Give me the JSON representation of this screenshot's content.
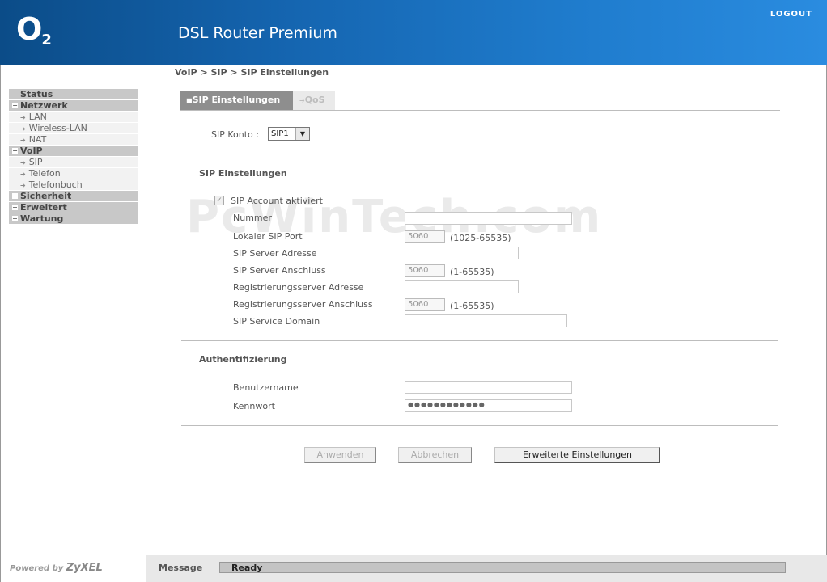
{
  "header": {
    "logo": "O",
    "logo_sub": "2",
    "product": "DSL Router Premium",
    "logout": "LOGOUT"
  },
  "breadcrumb": "VoIP > SIP > SIP Einstellungen",
  "sidebar": {
    "status": "Status",
    "netzwerk": "Netzwerk",
    "lan": "LAN",
    "wlan": "Wireless-LAN",
    "nat": "NAT",
    "voip": "VoIP",
    "sip": "SIP",
    "telefon": "Telefon",
    "telefonbuch": "Telefonbuch",
    "sicherheit": "Sicherheit",
    "erweitert": "Erweitert",
    "wartung": "Wartung"
  },
  "tabs": {
    "active": "SIP Einstellungen",
    "inactive": "QoS"
  },
  "form": {
    "sip_konto_label": "SIP Konto :",
    "sip_konto_value": "SIP1",
    "section_sip": "SIP Einstellungen",
    "sip_account_label": "SIP Account aktiviert",
    "nummer_label": "Nummer",
    "lokaler_port_label": "Lokaler SIP Port",
    "lokaler_port_value": "5060",
    "lokaler_port_range": "(1025-65535)",
    "server_adresse_label": "SIP Server Adresse",
    "server_anschluss_label": "SIP Server Anschluss",
    "server_anschluss_value": "5060",
    "server_anschluss_range": "(1-65535)",
    "reg_adresse_label": "Registrierungsserver Adresse",
    "reg_anschluss_label": "Registrierungsserver Anschluss",
    "reg_anschluss_value": "5060",
    "reg_anschluss_range": "(1-65535)",
    "service_domain_label": "SIP Service Domain",
    "section_auth": "Authentifizierung",
    "benutzername_label": "Benutzername",
    "kennwort_label": "Kennwort",
    "kennwort_value": "●●●●●●●●●●●●"
  },
  "buttons": {
    "anwenden": "Anwenden",
    "abbrechen": "Abbrechen",
    "erweitert": "Erweiterte Einstellungen"
  },
  "watermark": "PcWinTech.com",
  "footer": {
    "powered_by": "Powered by",
    "brand": "ZyXEL",
    "message_label": "Message",
    "message_value": "Ready"
  }
}
